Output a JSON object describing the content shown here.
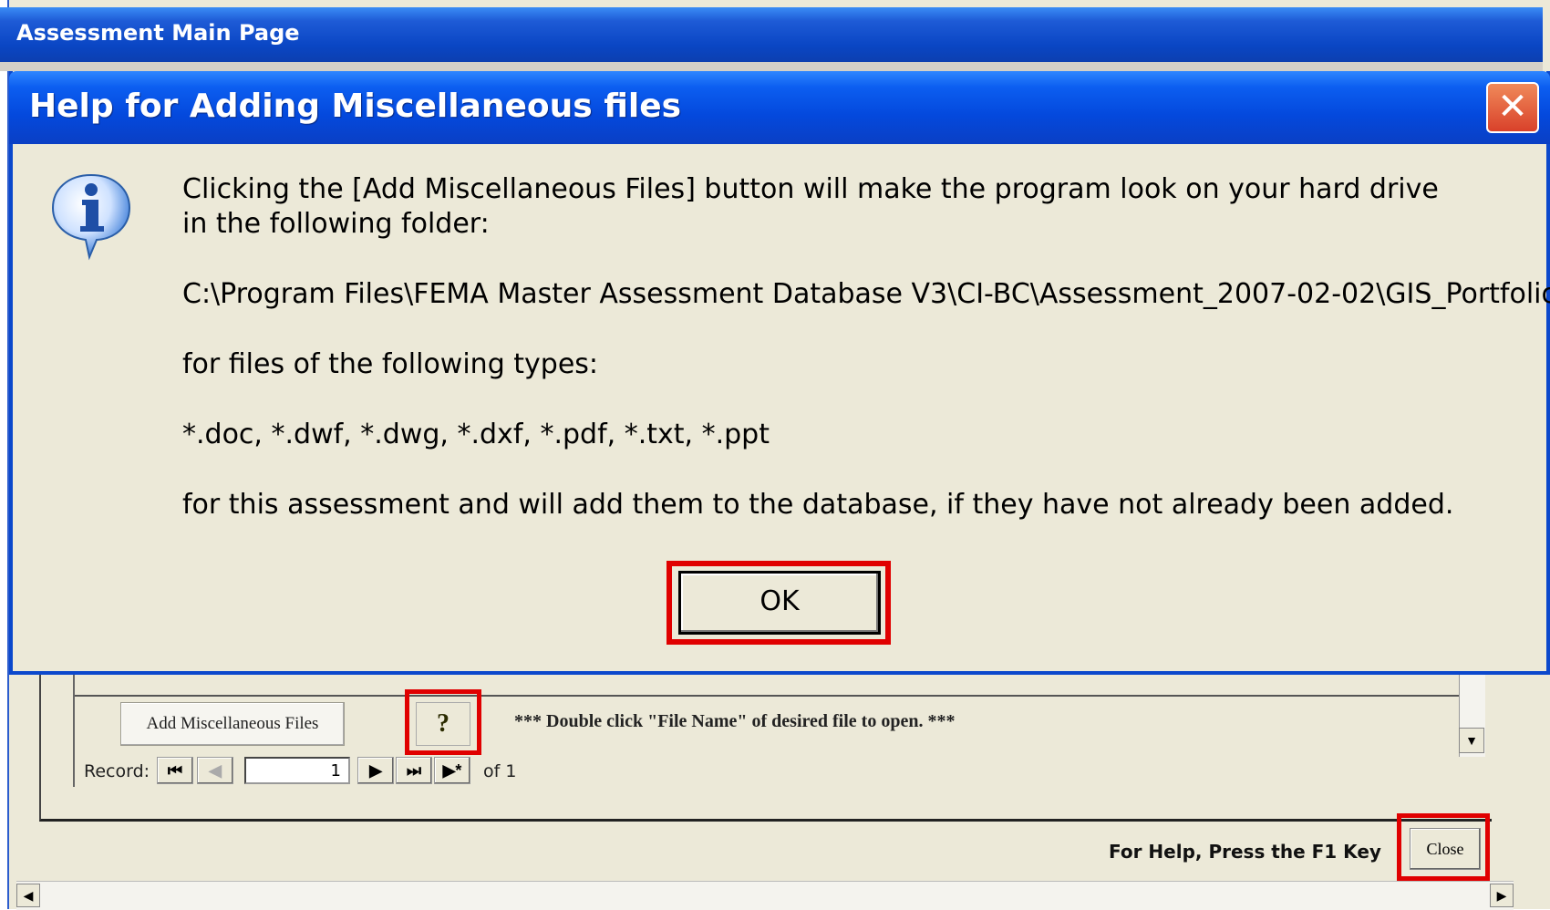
{
  "main_window": {
    "title": "Assessment Main Page"
  },
  "subform": {
    "add_misc_button": "Add Miscellaneous Files",
    "help_button": "?",
    "hint": "*** Double click \"File Name\" of desired file to open. ***",
    "record_label": "Record:",
    "record_value": "1",
    "record_of": "of  1",
    "nav": {
      "first": "⏮",
      "prev": "◀",
      "next": "▶",
      "last": "⏭",
      "new": "▶*"
    }
  },
  "footer": {
    "f1_help": "For Help, Press the F1 Key",
    "close_button": "Close"
  },
  "dialog": {
    "title": "Help for Adding Miscellaneous files",
    "close_glyph": "✕",
    "icon": "info-icon",
    "line1": "Clicking the [Add Miscellaneous Files] button will make the program look on your hard drive",
    "line2": "in the following folder:",
    "path": "C:\\Program Files\\FEMA Master Assessment Database V3\\CI-BC\\Assessment_2007-02-02\\GIS_Portfolio\\",
    "types_intro": "for files of the following types:",
    "types": "*.doc, *.dwf, *.dwg, *.dxf, *.pdf, *.txt, *.ppt",
    "outro": "for this assessment and will add them to the database, if they have not already been added.",
    "ok_button": "OK"
  },
  "colors": {
    "titlebar_blue": "#0449dd",
    "window_bg": "#ece9d8",
    "highlight_red": "#e00000"
  }
}
